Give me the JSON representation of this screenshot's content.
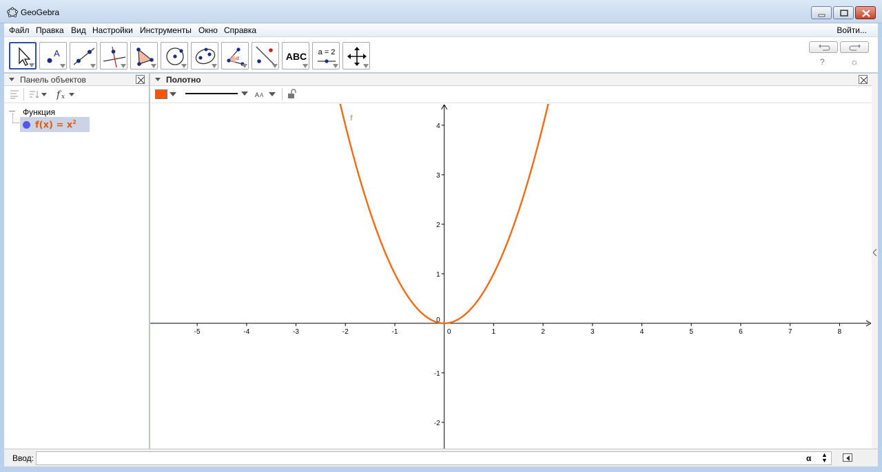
{
  "window": {
    "title": "GeoGebra"
  },
  "menu": {
    "items": [
      "Файл",
      "Правка",
      "Вид",
      "Настройки",
      "Инструменты",
      "Окно",
      "Справка"
    ],
    "signin": "Войти..."
  },
  "toolbar": {
    "tools": [
      {
        "name": "move-tool",
        "icon": "arrow-pointer-icon",
        "selected": true
      },
      {
        "name": "point-tool",
        "icon": "point-icon"
      },
      {
        "name": "line-tool",
        "icon": "line-icon"
      },
      {
        "name": "perpendicular-line-tool",
        "icon": "perpendicular-icon"
      },
      {
        "name": "polygon-tool",
        "icon": "polygon-icon"
      },
      {
        "name": "circle-tool",
        "icon": "circle-icon"
      },
      {
        "name": "ellipse-tool",
        "icon": "ellipse-icon"
      },
      {
        "name": "angle-tool",
        "icon": "angle-icon"
      },
      {
        "name": "reflect-tool",
        "icon": "reflect-icon"
      },
      {
        "name": "text-tool",
        "icon": "text-icon",
        "text": "ABC"
      },
      {
        "name": "slider-tool",
        "icon": "slider-icon",
        "text": "a = 2"
      },
      {
        "name": "move-graphics-tool",
        "icon": "move-cross-icon"
      }
    ],
    "help": "?",
    "settings": "☼"
  },
  "algebra": {
    "title": "Панель объектов",
    "group": "Функция",
    "function_label": "f(x) = x",
    "function_exp": "2",
    "function_color": "#e05a0a",
    "dot_color": "#4f59e6"
  },
  "graphics": {
    "title": "Полотно",
    "style_color": "#ff5500",
    "function_name": "f",
    "x_ticks": [
      "-5",
      "-4",
      "-3",
      "-2",
      "-1",
      "0",
      "1",
      "2",
      "3",
      "4",
      "5",
      "6",
      "7",
      "8"
    ],
    "y_ticks": [
      "-2",
      "-1",
      "1",
      "2",
      "3",
      "4"
    ],
    "x_tick_values": [
      -5,
      -4,
      -3,
      -2,
      -1,
      0,
      1,
      2,
      3,
      4,
      5,
      6,
      7,
      8
    ],
    "y_tick_values": [
      -2,
      -1,
      1,
      2,
      3,
      4
    ],
    "origin_y_label": "0",
    "x_range": [
      -5.95,
      8.65
    ],
    "y_range": [
      -2.53,
      4.43
    ],
    "curve_color": "#f06a14"
  },
  "input": {
    "label": "Ввод:",
    "value": "",
    "placeholder": "",
    "alpha": "α"
  }
}
